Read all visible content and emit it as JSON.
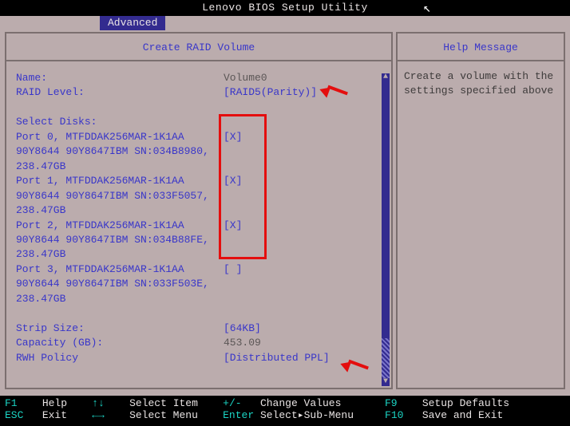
{
  "title": "Lenovo BIOS Setup Utility",
  "tab": "Advanced",
  "panel_title": "Create RAID Volume",
  "help_panel_title": "Help Message",
  "help_text": "Create a volume with the settings specified above",
  "fields": {
    "name_label": "Name:",
    "name_value": "Volume0",
    "raid_level_label": "RAID Level:",
    "raid_level_value": "[RAID5(Parity)]",
    "select_disks_label": "Select Disks:",
    "disks": [
      {
        "line1": "Port 0, MTFDDAK256MAR-1K1AA",
        "line2": "90Y8644 90Y8647IBM SN:034B8980,",
        "line3": "238.47GB",
        "check": "[X]"
      },
      {
        "line1": "Port 1, MTFDDAK256MAR-1K1AA",
        "line2": "90Y8644 90Y8647IBM SN:033F5057,",
        "line3": "238.47GB",
        "check": "[X]"
      },
      {
        "line1": "Port 2, MTFDDAK256MAR-1K1AA",
        "line2": "90Y8644 90Y8647IBM SN:034B88FE,",
        "line3": "238.47GB",
        "check": "[X]"
      },
      {
        "line1": "Port 3, MTFDDAK256MAR-1K1AA",
        "line2": "90Y8644 90Y8647IBM SN:033F503E,",
        "line3": "238.47GB",
        "check": "[ ]"
      }
    ],
    "strip_label": "Strip Size:",
    "strip_value": "[64KB]",
    "capacity_label": "Capacity (GB):",
    "capacity_value": "453.09",
    "rwh_label": "RWH Policy",
    "rwh_value": "[Distributed PPL]"
  },
  "footer": {
    "r1": {
      "k1": "F1",
      "l1": "Help",
      "a1": "↑↓",
      "l2": "Select Item",
      "k2": "+/-",
      "l3": "Change Values",
      "k3": "F9",
      "l4": "Setup Defaults"
    },
    "r2": {
      "k1": "ESC",
      "l1": "Exit",
      "a1": "←→",
      "l2": "Select Menu",
      "k2": "Enter",
      "l3": "Select▸Sub-Menu",
      "k3": "F10",
      "l4": "Save and Exit"
    }
  }
}
